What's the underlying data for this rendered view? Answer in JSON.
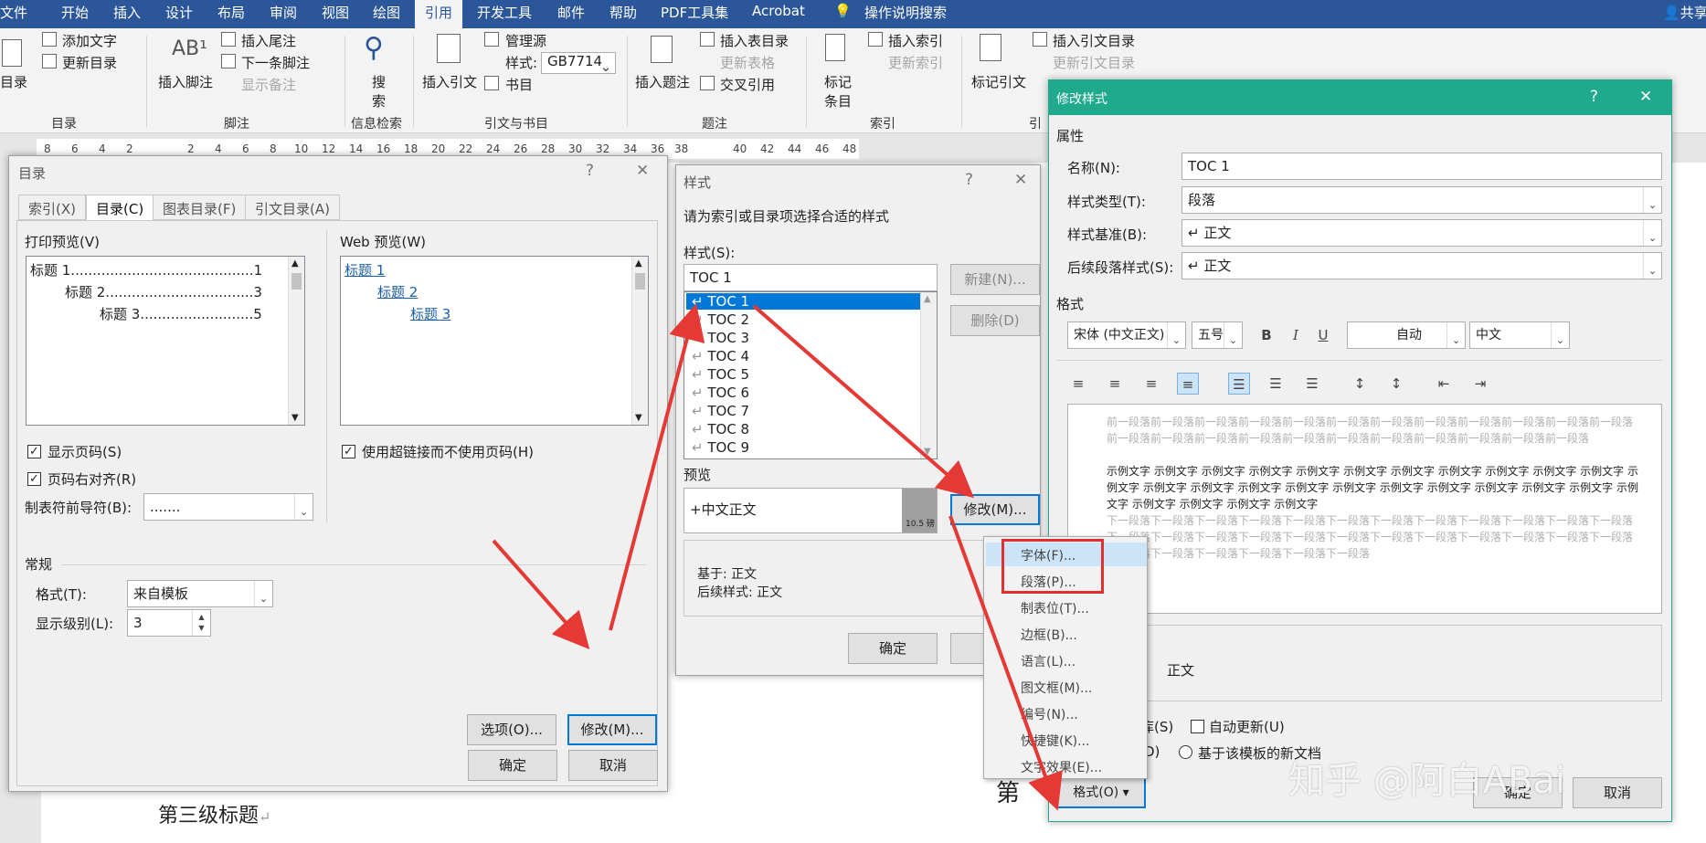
{
  "ribbon_tabs": [
    "文件",
    "开始",
    "插入",
    "设计",
    "布局",
    "审阅",
    "视图",
    "绘图",
    "引用",
    "开发工具",
    "邮件",
    "帮助",
    "PDF工具集",
    "Acrobat",
    "操作说明搜索"
  ],
  "share": "共享",
  "ribbon": {
    "toc": "目录",
    "add_text": "添加文字",
    "update_toc": "更新目录",
    "grp_toc": "目录",
    "insert_footnote": "插入脚注",
    "insert_endnote": "插入尾注",
    "next_footnote": "下一条脚注",
    "show_notes": "显示备注",
    "grp_footnote": "脚注",
    "search": "搜索",
    "grp_info": "信息检索",
    "insert_citation": "插入引文",
    "manage_sources": "管理源",
    "style_label": "样式:",
    "style_value": "GB7714",
    "bibliography": "书目",
    "grp_citation": "引文与书目",
    "insert_caption": "插入题注",
    "insert_tof": "插入表目录",
    "update_table": "更新表格",
    "cross_ref": "交叉引用",
    "grp_caption": "题注",
    "mark_entry": "标记条目",
    "insert_index": "插入索引",
    "update_index": "更新索引",
    "grp_index": "索引",
    "mark_citation": "标记引文",
    "insert_toa": "插入引文目录",
    "update_toa": "更新引文目录",
    "grp_toa": "引"
  },
  "ruler": [
    "8",
    "6",
    "4",
    "2",
    "2",
    "4",
    "6",
    "8",
    "10",
    "12",
    "14",
    "16",
    "18",
    "20",
    "22",
    "24",
    "26",
    "28",
    "30",
    "32",
    "34",
    "36",
    "38",
    "40",
    "42",
    "44",
    "46",
    "48"
  ],
  "doc": {
    "heading3": "第三级标题",
    "heading_partial": "第"
  },
  "toc_dialog": {
    "title": "目录",
    "help": "?",
    "close": "✕",
    "tabs": [
      "索引(X)",
      "目录(C)",
      "图表目录(F)",
      "引文目录(A)"
    ],
    "print_preview_label": "打印预览(V)",
    "print_lines": [
      "标题 1..........................................1",
      "标题 2..................................3",
      "标题 3..........................5"
    ],
    "web_preview_label": "Web 预览(W)",
    "web_lines": [
      "标题 1",
      "标题 2",
      "标题 3"
    ],
    "show_page_numbers": "显示页码(S)",
    "right_align": "页码右对齐(R)",
    "use_hyperlinks": "使用超链接而不使用页码(H)",
    "tab_leader_label": "制表符前导符(B):",
    "tab_leader_value": ".......",
    "general": "常规",
    "formats_label": "格式(T):",
    "formats_value": "来自模板",
    "levels_label": "显示级别(L):",
    "levels_value": "3",
    "options": "选项(O)...",
    "modify": "修改(M)...",
    "ok": "确定",
    "cancel": "取消"
  },
  "style_dialog": {
    "title": "样式",
    "help": "?",
    "close": "✕",
    "instruction": "请为索引或目录项选择合适的样式",
    "styles_label": "样式(S):",
    "style_input": "TOC 1",
    "styles": [
      "TOC 1",
      "TOC 2",
      "TOC 3",
      "TOC 4",
      "TOC 5",
      "TOC 6",
      "TOC 7",
      "TOC 8",
      "TOC 9"
    ],
    "new": "新建(N)...",
    "delete": "删除(D)",
    "preview_label": "预览",
    "preview_text": "+中文正文",
    "preview_size": "10.5 磅",
    "modify": "修改(M)...",
    "based_on": "基于: 正文",
    "following": "后续样式: 正文",
    "ok": "确定",
    "cancel_partial": "I"
  },
  "format_menu": [
    "字体(F)...",
    "段落(P)...",
    "制表位(T)...",
    "边框(B)...",
    "语言(L)...",
    "图文框(M)...",
    "编号(N)...",
    "快捷键(K)...",
    "文字效果(E)..."
  ],
  "modify_dialog": {
    "title": "修改样式",
    "help": "?",
    "close": "✕",
    "properties": "属性",
    "name_label": "名称(N):",
    "name_value": "TOC 1",
    "type_label": "样式类型(T):",
    "type_value": "段落",
    "based_label": "样式基准(B):",
    "based_value": "↵ 正文",
    "following_label": "后续段落样式(S):",
    "following_value": "↵ 正文",
    "format_label": "格式",
    "font": "宋体 (中文正文)",
    "size": "五号",
    "bold": "B",
    "italic": "I",
    "underline": "U",
    "color": "自动",
    "lang": "中文",
    "prev_before": "前一段落前一段落前一段落前一段落前一段落前一段落前一段落前一段落前一段落前一段落前一段落前一段落前一段落前一段落前一段落前一段落前一段落前一段落前一段落前一段落前一段落前一段落前一段落",
    "prev_sample": "示例文字 示例文字 示例文字 示例文字 示例文字 示例文字 示例文字 示例文字 示例文字 示例文字 示例文字 示例文字 示例文字 示例文字 示例文字 示例文字 示例文字 示例文字 示例文字 示例文字 示例文字 示例文字 示例文字 示例文字 示例文字 示例文字 示例文字",
    "prev_after": "下一段落下一段落下一段落下一段落下一段落下一段落下一段落下一段落下一段落下一段落下一段落下一段落下一段落下一段落下一段落下一段落下一段落下一段落下一段落下一段落下一段落下一段落下一段落下一段落下一段落下一段落下一段落下一段落下一段落下一段落",
    "desc_partial": "正文",
    "add_gallery_partial": "库(S)",
    "auto_update": "自动更新(U)",
    "doc_partial": "D)",
    "new_docs": "基于该模板的新文档",
    "format_btn": "格式(O) ▾",
    "ok": "确定",
    "cancel": "取消"
  },
  "watermark": "知乎 @阿白ABai",
  "colors": {
    "ribbon_blue": "#2b579a",
    "dialog_green": "#1faa8e",
    "select_blue": "#0078d7",
    "arrow_red": "#e53935"
  }
}
